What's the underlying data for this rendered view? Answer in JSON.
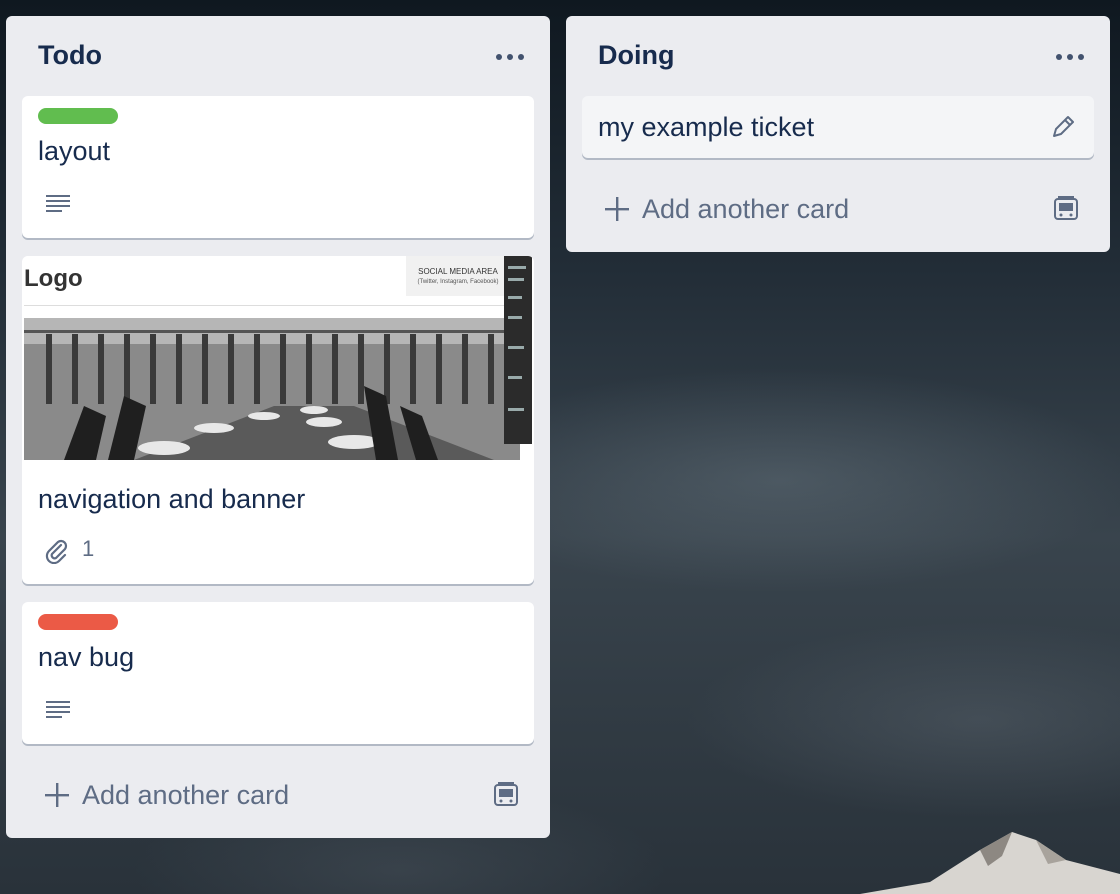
{
  "lists": [
    {
      "title": "Todo",
      "cards": [
        {
          "title": "layout",
          "label_color": "#61bd4f",
          "badge": "description-icon"
        },
        {
          "title": "navigation and banner",
          "attachment_count": "1",
          "cover": {
            "logo_text": "Logo",
            "social_title": "SOCIAL MEDIA AREA",
            "social_sub": "(Twitter, Instagram, Facebook)"
          }
        },
        {
          "title": "nav bug",
          "label_color": "#eb5a46",
          "badge": "description-icon"
        }
      ],
      "add_label": "Add another card"
    },
    {
      "title": "Doing",
      "cards": [
        {
          "title": "my example ticket"
        }
      ],
      "add_label": "Add another card"
    }
  ],
  "colors": {
    "list_bg": "#ebecf0",
    "text": "#172b4d",
    "muted": "#5e6c84"
  }
}
